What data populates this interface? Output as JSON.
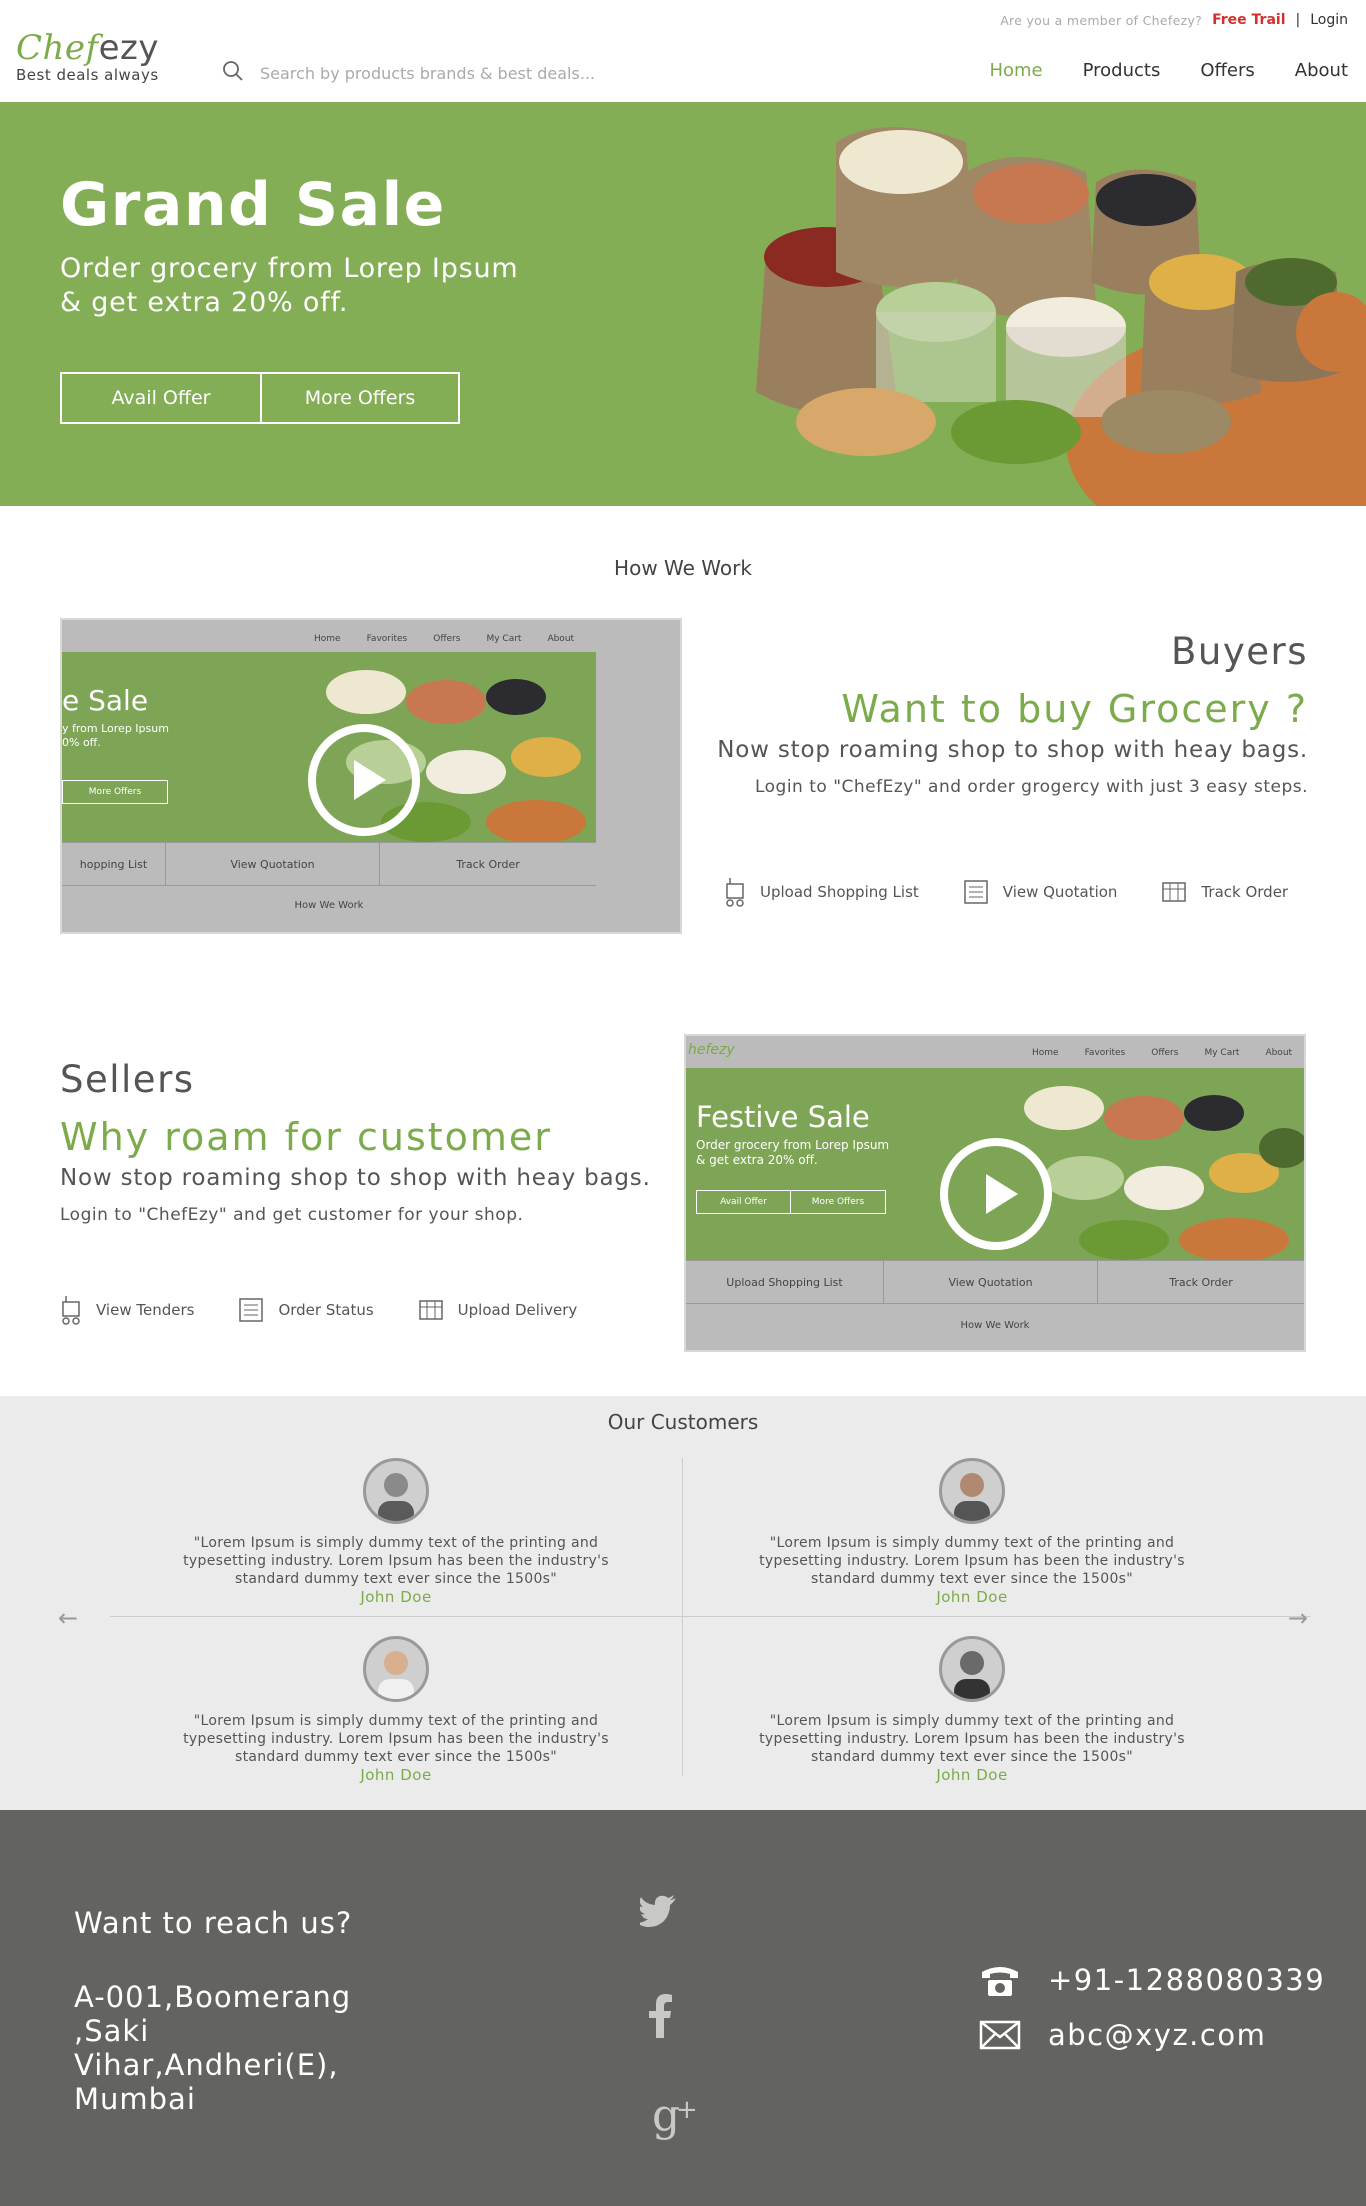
{
  "header": {
    "member_question": "Are you a member of Chefezy?",
    "free_trial": "Free Trail",
    "separator": "|",
    "login": "Login",
    "logo_part1": "Chef",
    "logo_part2": "ezy",
    "tagline": "Best deals always",
    "search_placeholder": "Search by products brands & best deals..."
  },
  "nav": {
    "items": [
      "Home",
      "Products",
      "Offers",
      "About"
    ],
    "active": "Home"
  },
  "hero": {
    "title": "Grand Sale",
    "subtitle_line1": "Order grocery from Lorep Ipsum",
    "subtitle_line2": "& get extra 20% off.",
    "btn_avail": "Avail Offer",
    "btn_more": "More Offers"
  },
  "how_we_work": {
    "title": "How We Work",
    "buyers": {
      "heading": "Buyers",
      "subheading": "Want to buy Grocery ?",
      "text": "Now stop roaming shop to shop with heay bags.",
      "small": "Login to \"ChefEzy\" and order grogercy with just 3 easy steps.",
      "steps": [
        "Upload Shopping List",
        "View Quotation",
        "Track Order"
      ],
      "video": {
        "nav": [
          "Home",
          "Favorites",
          "Offers",
          "My Cart",
          "About"
        ],
        "title": "e Sale",
        "sub_line1": "y from Lorep Ipsum",
        "sub_line2": "0% off.",
        "btn": "More Offers",
        "bar": [
          "hopping List",
          "View Quotation",
          "Track Order"
        ],
        "how": "How We Work"
      }
    },
    "sellers": {
      "heading": "Sellers",
      "subheading": "Why roam for customer",
      "text": "Now stop roaming shop to shop with heay bags.",
      "small": "Login to \"ChefEzy\" and get customer for your shop.",
      "steps": [
        "View Tenders",
        "Order Status",
        "Upload Delivery"
      ],
      "video": {
        "logo": "hefezy",
        "nav": [
          "Home",
          "Favorites",
          "Offers",
          "My Cart",
          "About"
        ],
        "title": "Festive Sale",
        "sub_line1": "Order grocery from Lorep Ipsum",
        "sub_line2": "& get extra 20% off.",
        "btn1": "Avail Offer",
        "btn2": "More Offers",
        "bar": [
          "Upload Shopping List",
          "View Quotation",
          "Track Order"
        ],
        "how": "How We Work"
      }
    }
  },
  "customers": {
    "title": "Our Customers",
    "testimonials": [
      {
        "text": "\"Lorem Ipsum is simply dummy text of the printing and typesetting industry. Lorem Ipsum has been the industry's standard dummy text ever since the 1500s\"",
        "name": "John Doe"
      },
      {
        "text": "\"Lorem Ipsum is simply dummy text of the printing and typesetting industry. Lorem Ipsum has been the industry's standard dummy text ever since the 1500s\"",
        "name": "John Doe"
      },
      {
        "text": "\"Lorem Ipsum is simply dummy text of the printing and typesetting industry. Lorem Ipsum has been the industry's standard dummy text ever since the 1500s\"",
        "name": "John Doe"
      },
      {
        "text": "\"Lorem Ipsum is simply dummy text of the printing and typesetting industry. Lorem Ipsum has been the industry's standard dummy text ever since the 1500s\"",
        "name": "John Doe"
      }
    ]
  },
  "footer": {
    "title": "Want to reach us?",
    "address_line1": "A-001,Boomerang",
    "address_line2": ",Saki Vihar,Andheri(E),",
    "address_line3": "Mumbai",
    "phone": "+91-1288080339",
    "email": "abc@xyz.com",
    "social": [
      "twitter-icon",
      "facebook-icon",
      "google-plus-icon"
    ]
  },
  "colors": {
    "accent": "#7bab4a",
    "hero_bg": "#84ae55",
    "footer_bg": "#636360",
    "alert": "#d0312d"
  }
}
